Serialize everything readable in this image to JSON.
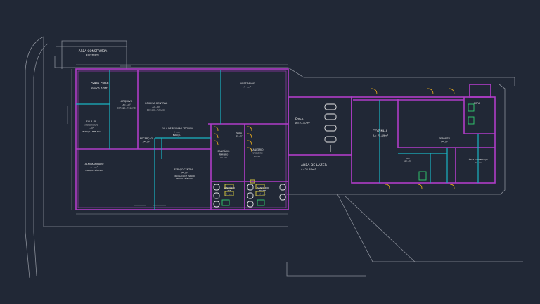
{
  "drawing": {
    "colors": {
      "background": "#212836",
      "outline": "#8a8f99",
      "wall": "#b03cc8",
      "partition": "#19b4c4",
      "fixture": "#e6e6e6",
      "door": "#d8a020",
      "fixture_yellow": "#e0d040",
      "fixture_green": "#30d070",
      "label": "#e8e8e8"
    }
  },
  "labels": {
    "top_note": [
      "ÁREA CONSTRUÍDA",
      "EXISTENTE"
    ],
    "sala_fiale": [
      "Sala Fiale",
      "A=23.87m²"
    ],
    "arquivo": [
      "ARQUIVO",
      "A=...m²",
      "ESPAÇO...M.QUAD"
    ],
    "central_left": [
      "SALA DE",
      "ATENDIMENTO",
      "...m²",
      "ESPAÇO...PÚBLICO"
    ],
    "oficina_central": [
      "OFICINA CENTRAL",
      "A=...m²",
      "ESPAÇO...PÚBLICO"
    ],
    "vestiarios_label": [
      "VESTIÁRIOS",
      "A=...m²"
    ],
    "recepcao": [
      "RECEPÇÃO",
      "A=...m²"
    ],
    "sala_reuniao": [
      "SALA DE REUNIÃO TÉCNICA",
      "A=...m²",
      "ESPAÇO..."
    ],
    "almoxarifado": [
      "ALMOXARIFADO",
      "A=...m²",
      "ESPAÇO...PÚBLICO"
    ],
    "espaco_central": [
      "ESPAÇO CENTRAL",
      "A=...m²",
      "CIRCULAÇÃO E ESPAÇO",
      "ESPAÇO...PÚBLICO"
    ],
    "sanitario_fem": [
      "SANITÁRIO",
      "FEMININO",
      "A=...m²"
    ],
    "sanitario_masc": [
      "SANITÁRIO",
      "MASCULINO",
      "A=...m²"
    ],
    "sanitario_pne_1": [
      "SANITÁRIO",
      "PNE",
      "A=...m²"
    ],
    "sanitario_pne_2": [
      "SANITÁRIO",
      "PNE/FEM",
      "A=...m²"
    ],
    "sala_direita": [
      "SALA",
      "A=...m²"
    ],
    "deck": [
      "Deck",
      "A=27.87m²"
    ],
    "area_de_lazer": [
      "ÁREA DE LAZER",
      "A=21.87m²"
    ],
    "cozinha": [
      "COZINHA",
      "A= 75.89m²"
    ],
    "dep_right": [
      "DEPÓSITO",
      "A=...m²"
    ],
    "copa": [
      "COPA"
    ],
    "wc_right": [
      "W.C.",
      "A=...m²"
    ],
    "servico": [
      "ÁREA DE SERVIÇO",
      "A=...m²"
    ]
  }
}
